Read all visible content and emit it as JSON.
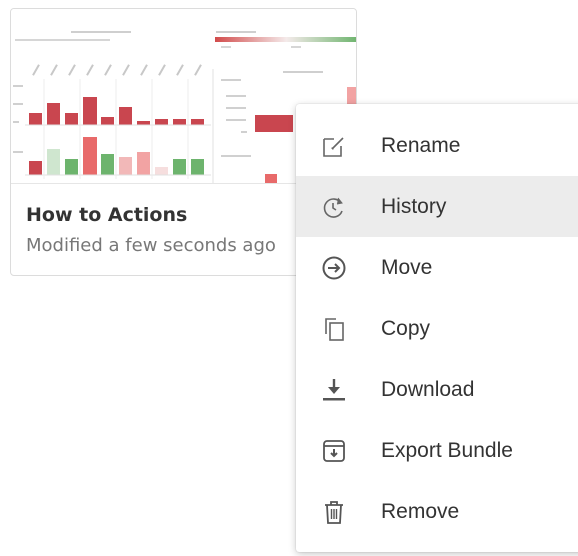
{
  "card": {
    "title": "How to Actions",
    "subtitle": "Modified a few seconds ago"
  },
  "menu": {
    "items": [
      {
        "label": "Rename",
        "icon": "rename-icon"
      },
      {
        "label": "History",
        "icon": "history-icon"
      },
      {
        "label": "Move",
        "icon": "move-icon"
      },
      {
        "label": "Copy",
        "icon": "copy-icon"
      },
      {
        "label": "Download",
        "icon": "download-icon"
      },
      {
        "label": "Export Bundle",
        "icon": "export-bundle-icon"
      },
      {
        "label": "Remove",
        "icon": "trash-icon"
      }
    ],
    "hovered_item": "History"
  },
  "colors": {
    "icon": "#666666",
    "text": "#333333",
    "hover_bg": "#ececec",
    "bar_red": "#c9464f",
    "bar_pink": "#f2a3a3",
    "bar_green": "#6db46d",
    "bar_light_green": "#cfe6cf"
  }
}
